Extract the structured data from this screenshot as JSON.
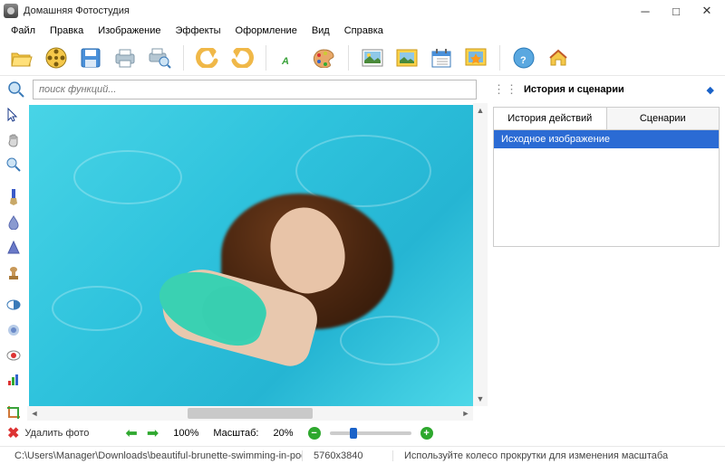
{
  "app": {
    "title": "Домашняя Фотостудия"
  },
  "menu": [
    "Файл",
    "Правка",
    "Изображение",
    "Эффекты",
    "Оформление",
    "Вид",
    "Справка"
  ],
  "toolbar_icons": [
    "folder-open",
    "film-reel",
    "save",
    "print",
    "print-preview",
    "undo",
    "redo",
    "text",
    "palette",
    "image",
    "photo",
    "calendar",
    "star-photo",
    "help",
    "home"
  ],
  "search": {
    "placeholder": "поиск функций..."
  },
  "side_panel": {
    "title": "История и сценарии"
  },
  "tabs": {
    "history": "История действий",
    "scenarios": "Сценарии"
  },
  "history": {
    "items": [
      "Исходное изображение"
    ]
  },
  "left_tools": [
    "cursor",
    "hand",
    "zoom",
    "brush",
    "drop",
    "cone",
    "stamp",
    "contrast",
    "blur",
    "eye",
    "levels",
    "crop"
  ],
  "bottom": {
    "delete_label": "Удалить фото",
    "zoom_percent": "100%",
    "scale_label": "Масштаб:",
    "scale_value": "20%"
  },
  "status": {
    "path": "C:\\Users\\Manager\\Downloads\\beautiful-brunette-swimming-in-pool-JPRZEMB.jpg",
    "dimensions": "5760x3840",
    "hint": "Используйте колесо прокрутки для изменения масштаба"
  },
  "colors": {
    "accent": "#2b6bd4",
    "green": "#2ea82e"
  }
}
